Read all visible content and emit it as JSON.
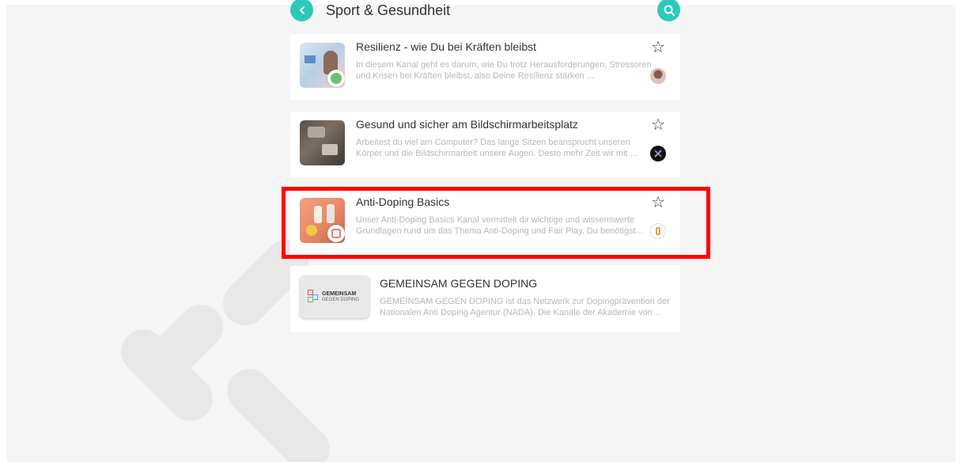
{
  "header": {
    "title": "Sport & Gesundheit",
    "back_icon": "chevron-left-icon",
    "search_icon": "search-icon"
  },
  "channels": [
    {
      "title": "Resilienz - wie Du bei Kräften bleibst",
      "description": "In diesem Kanal geht es darum, wie Du trotz Herausforderungen, Stressoren und Krisen bei Kräften bleibst, also Deine Resilienz stärken ...",
      "star": "☆"
    },
    {
      "title": "Gesund und sicher am Bildschirmarbeitsplatz",
      "description": "Arbeitest du viel am Computer? Das lange Sitzen beansprucht unseren Körper und die Bildschirmarbeit unsere Augen. Desto mehr Zeit wir mit ...",
      "star": "☆"
    },
    {
      "title": "Anti-Doping Basics",
      "description": "Unser Anti-Doping Basics Kanal vermittelt dir wichtige und wissenswerte Grundlagen rund um das Thema Anti-Doping und Fair Play. Du benötigst...",
      "star": "☆"
    },
    {
      "title": "GEMEINSAM GEGEN DOPING",
      "description": "GEMEINSAM GEGEN DOPING ist das Netzwerk zur Dopingprävention der Nationalen Anti Doping Agentur (NADA). Die Kanäle der Akademie von ...",
      "logo_text_1": "GEMEINSAM",
      "logo_text_2": "GEGEN DOPING"
    }
  ],
  "colors": {
    "accent": "#2cc9b8",
    "highlight": "#ff0000"
  }
}
